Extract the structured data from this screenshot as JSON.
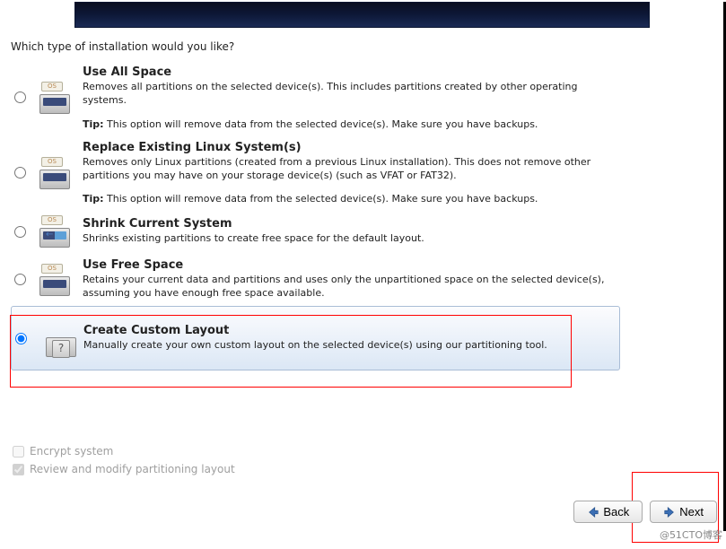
{
  "question": "Which type of installation would you like?",
  "options": [
    {
      "key": "use-all",
      "title": "Use All Space",
      "desc": "Removes all partitions on the selected device(s).  This includes partitions created by other operating systems.",
      "tip_label": "Tip:",
      "tip": "This option will remove data from the selected device(s).  Make sure you have backups.",
      "icon": "drive"
    },
    {
      "key": "replace-linux",
      "title": "Replace Existing Linux System(s)",
      "desc": "Removes only Linux partitions (created from a previous Linux installation).  This does not remove other partitions you may have on your storage device(s) (such as VFAT or FAT32).",
      "tip_label": "Tip:",
      "tip": "This option will remove data from the selected device(s).  Make sure you have backups.",
      "icon": "drive"
    },
    {
      "key": "shrink",
      "title": "Shrink Current System",
      "desc": "Shrinks existing partitions to create free space for the default layout.",
      "icon": "shrink"
    },
    {
      "key": "free-space",
      "title": "Use Free Space",
      "desc": "Retains your current data and partitions and uses only the unpartitioned space on the selected device(s), assuming you have enough free space available.",
      "icon": "drive"
    },
    {
      "key": "custom",
      "title": "Create Custom Layout",
      "desc": "Manually create your own custom layout on the selected device(s) using our partitioning tool.",
      "icon": "question"
    }
  ],
  "selected_option": "custom",
  "checks": {
    "encrypt_label": "Encrypt system",
    "encrypt_checked": false,
    "review_label": "Review and modify partitioning layout",
    "review_checked": true
  },
  "nav": {
    "back_label": "Back",
    "next_label": "Next"
  },
  "os_tag": "OS",
  "watermark": "@51CTO博客"
}
